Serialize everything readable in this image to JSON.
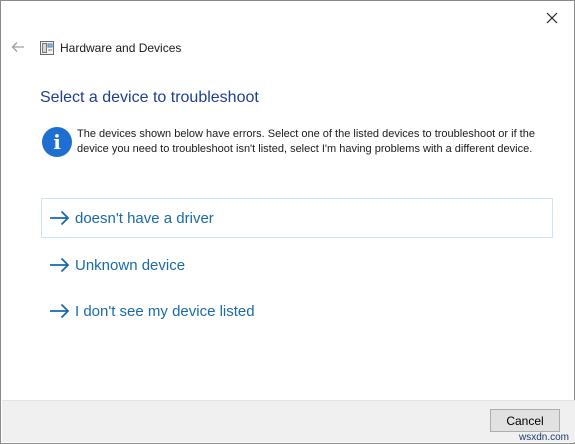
{
  "window": {
    "title": "",
    "close_label": "close"
  },
  "nav": {
    "breadcrumb": "Hardware and Devices"
  },
  "main": {
    "title": "Select a device to troubleshoot",
    "info_glyph": "i",
    "info_text": "The devices shown below have errors. Select one of the listed devices to troubleshoot or if the device you need to troubleshoot isn't listed, select I'm having problems with a different device.",
    "options": [
      {
        "label": "doesn't have a driver",
        "selected": true
      },
      {
        "label": "Unknown device",
        "selected": false
      },
      {
        "label": "I don't see my device listed",
        "selected": false
      }
    ]
  },
  "footer": {
    "cancel_label": "Cancel"
  },
  "watermark": "wsxdn.com",
  "colors": {
    "title": "#1e3f91",
    "link": "#1a6aa8",
    "info": "#1f6fd0",
    "selected_border": "#cce4f7"
  }
}
